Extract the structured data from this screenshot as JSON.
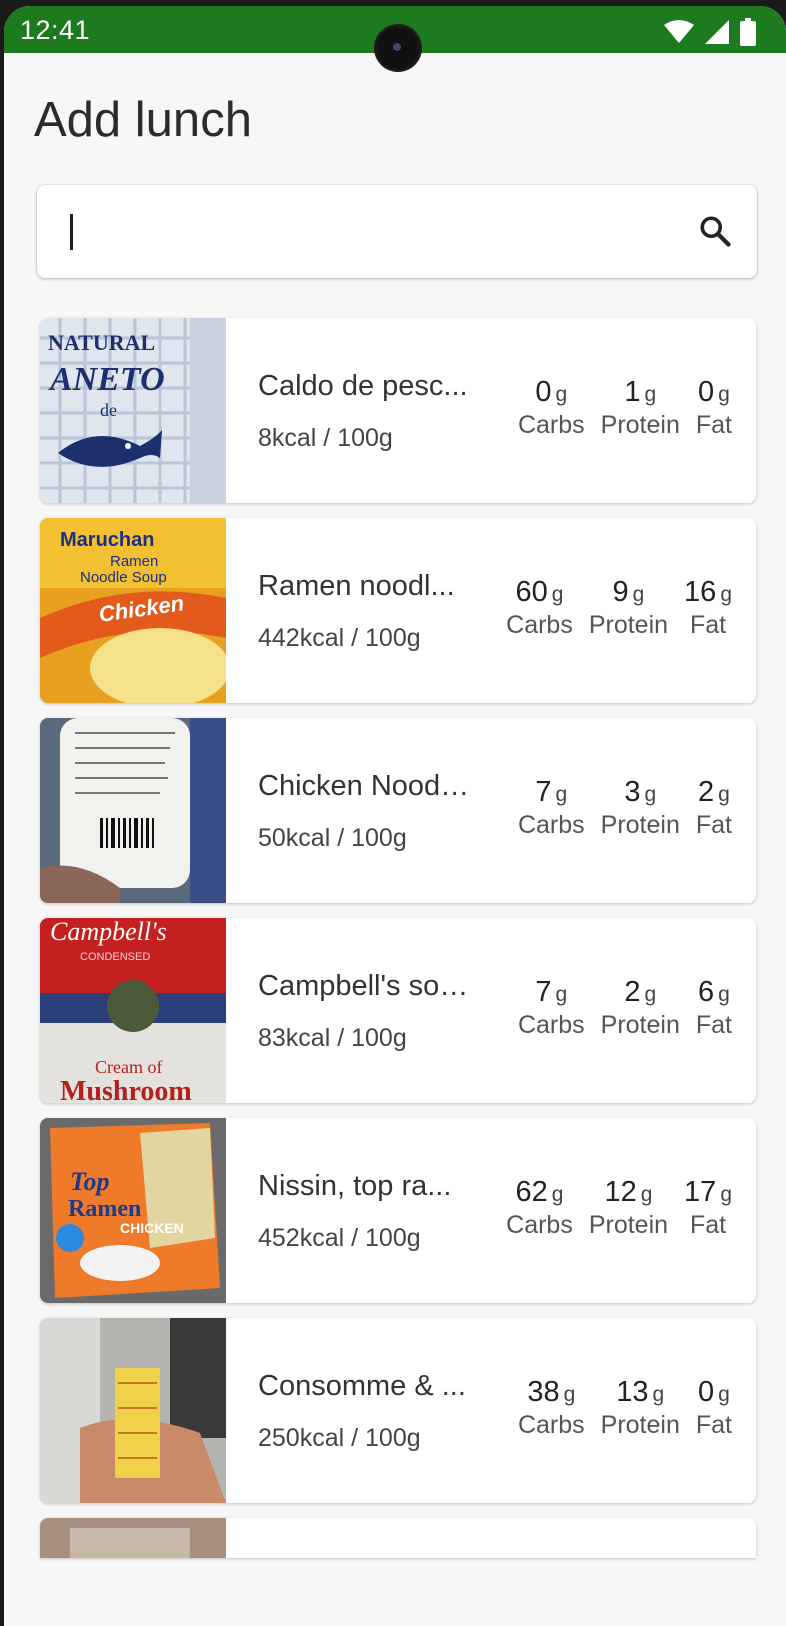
{
  "status_bar": {
    "time": "12:41"
  },
  "page_title": "Add lunch",
  "search": {
    "value": "",
    "placeholder": ""
  },
  "foods": [
    {
      "name": "Caldo de pesc...",
      "kcal": "8kcal / 100g",
      "carbs": "0",
      "protein": "1",
      "fat": "0"
    },
    {
      "name": "Ramen noodl...",
      "kcal": "442kcal / 100g",
      "carbs": "60",
      "protein": "9",
      "fat": "16"
    },
    {
      "name": "Chicken Noodl...",
      "kcal": "50kcal / 100g",
      "carbs": "7",
      "protein": "3",
      "fat": "2"
    },
    {
      "name": "Campbell's sou...",
      "kcal": "83kcal / 100g",
      "carbs": "7",
      "protein": "2",
      "fat": "6"
    },
    {
      "name": "Nissin, top ra...",
      "kcal": "452kcal / 100g",
      "carbs": "62",
      "protein": "12",
      "fat": "17"
    },
    {
      "name": "Consomme & ...",
      "kcal": "250kcal / 100g",
      "carbs": "38",
      "protein": "13",
      "fat": "0"
    }
  ],
  "labels": {
    "unit": "g",
    "carbs": "Carbs",
    "protein": "Protein",
    "fat": "Fat"
  },
  "thumbnail_text": {
    "item_0": [
      "NATURAL",
      "ANETO",
      "de"
    ],
    "item_1": [
      "Maruchan",
      "Ramen",
      "Noodle Soup",
      "Chicken"
    ],
    "item_3": [
      "Campbell's",
      "CONDENSED",
      "Cream of",
      "Mushroom"
    ],
    "item_4": [
      "Top",
      "Ramen",
      "CHICKEN"
    ]
  },
  "colors": {
    "status_bar": "#1e7a1e",
    "background": "#f7f7f7",
    "card": "#ffffff"
  }
}
